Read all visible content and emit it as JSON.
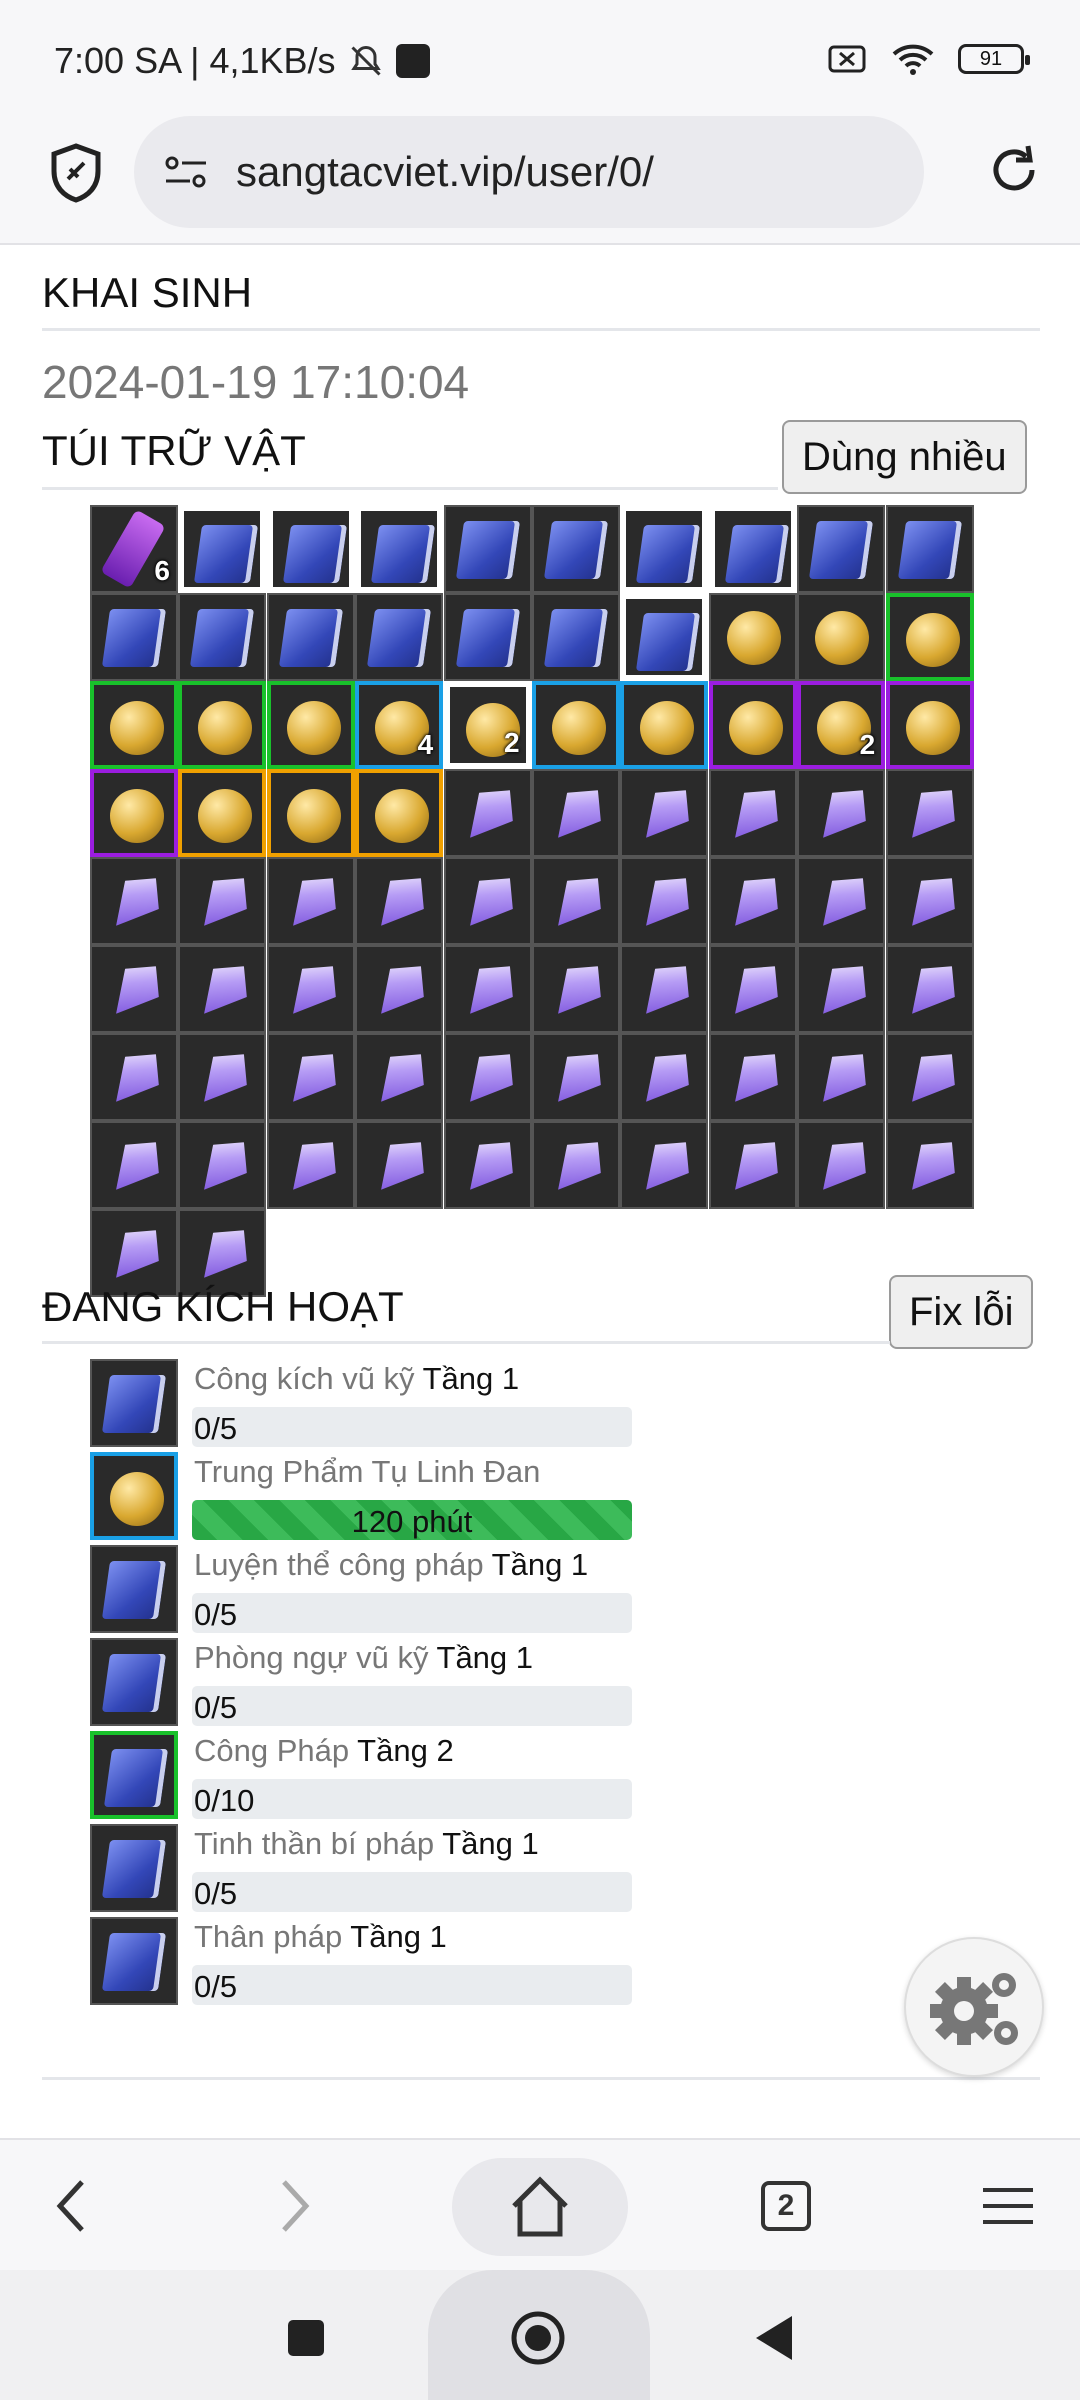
{
  "status_bar": {
    "time_speed": "7:00 SA | 4,1KB/s",
    "battery": "91"
  },
  "browser": {
    "url": "sangtacviet.vip/user/0/",
    "tab_count": "2"
  },
  "profile": {
    "khai_sinh_title": "KHAI SINH",
    "khai_sinh_date": "2024-01-19 17:10:04"
  },
  "inventory": {
    "title": "TÚI TRỮ VẬT",
    "use_many_label": "Dùng nhiều",
    "quantities": [
      "6",
      "4",
      "2",
      "2"
    ]
  },
  "active": {
    "title": "ĐANG KÍCH HOẠT",
    "fix_label": "Fix lỗi",
    "items": [
      {
        "name": "Công kích vũ kỹ",
        "tier": "Tầng 1",
        "progress": "0/5"
      },
      {
        "name": "Trung Phẩm Tụ Linh Đan",
        "tier": "",
        "progress": "120 phút"
      },
      {
        "name": "Luyện thể công pháp",
        "tier": "Tầng 1",
        "progress": "0/5"
      },
      {
        "name": "Phòng ngự vũ kỹ",
        "tier": "Tầng 1",
        "progress": "0/5"
      },
      {
        "name": "Công Pháp",
        "tier": "Tầng 2",
        "progress": "0/10"
      },
      {
        "name": "Tinh thần bí pháp",
        "tier": "Tầng 1",
        "progress": "0/5"
      },
      {
        "name": "Thân pháp",
        "tier": "Tầng 1",
        "progress": "0/5"
      }
    ]
  },
  "colors": {
    "rarity_green": "#19c12b",
    "rarity_blue": "#1aa0e6",
    "rarity_purple": "#9b1de0",
    "rarity_orange": "#f0a000",
    "selected_red": "#e20000",
    "progress_green": "#28a745"
  }
}
